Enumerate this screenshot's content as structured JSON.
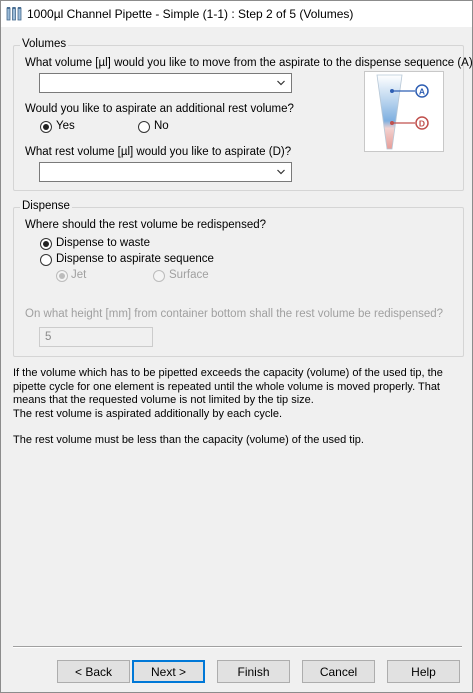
{
  "window": {
    "title": "1000µl Channel Pipette - Simple (1-1) : Step 2 of 5 (Volumes)",
    "icon": "pipette-tubes-icon"
  },
  "volumes": {
    "legend": "Volumes",
    "q_volume": "What volume [µl] would you like to move from the aspirate to the dispense sequence (A)?",
    "volume_value": "",
    "q_rest": "Would you like to aspirate an additional rest volume?",
    "opt_yes": "Yes",
    "opt_no": "No",
    "selected": "Yes",
    "q_rest_volume": "What rest volume [µl] would you like to aspirate (D)?",
    "rest_volume_value": "",
    "illustration": {
      "label_a": "A",
      "label_d": "D",
      "color_a": "#2f5fb3",
      "color_d": "#c0504d"
    }
  },
  "dispense": {
    "legend": "Dispense",
    "q_where": "Where should the rest volume be redispensed?",
    "opt_waste": "Dispense to waste",
    "opt_aspirate_seq": "Dispense to aspirate sequence",
    "selected": "Dispense to waste",
    "sub_jet": "Jet",
    "sub_surface": "Surface",
    "sub_selected": "Jet",
    "q_height": "On what height [mm] from container bottom shall the rest volume be redispensed?",
    "height_value": "5"
  },
  "info": {
    "para1": "If the volume which has to be pipetted exceeds the capacity (volume) of the used tip, the pipette cycle for one element is repeated until the whole volume is moved properly. That means that the requested volume is not limited by the tip size.",
    "para2": "The rest volume is aspirated additionally by each cycle.",
    "para3": "The rest volume must be less than the capacity (volume) of the used tip."
  },
  "buttons": {
    "back": "< Back",
    "next": "Next >",
    "finish": "Finish",
    "cancel": "Cancel",
    "help": "Help"
  }
}
